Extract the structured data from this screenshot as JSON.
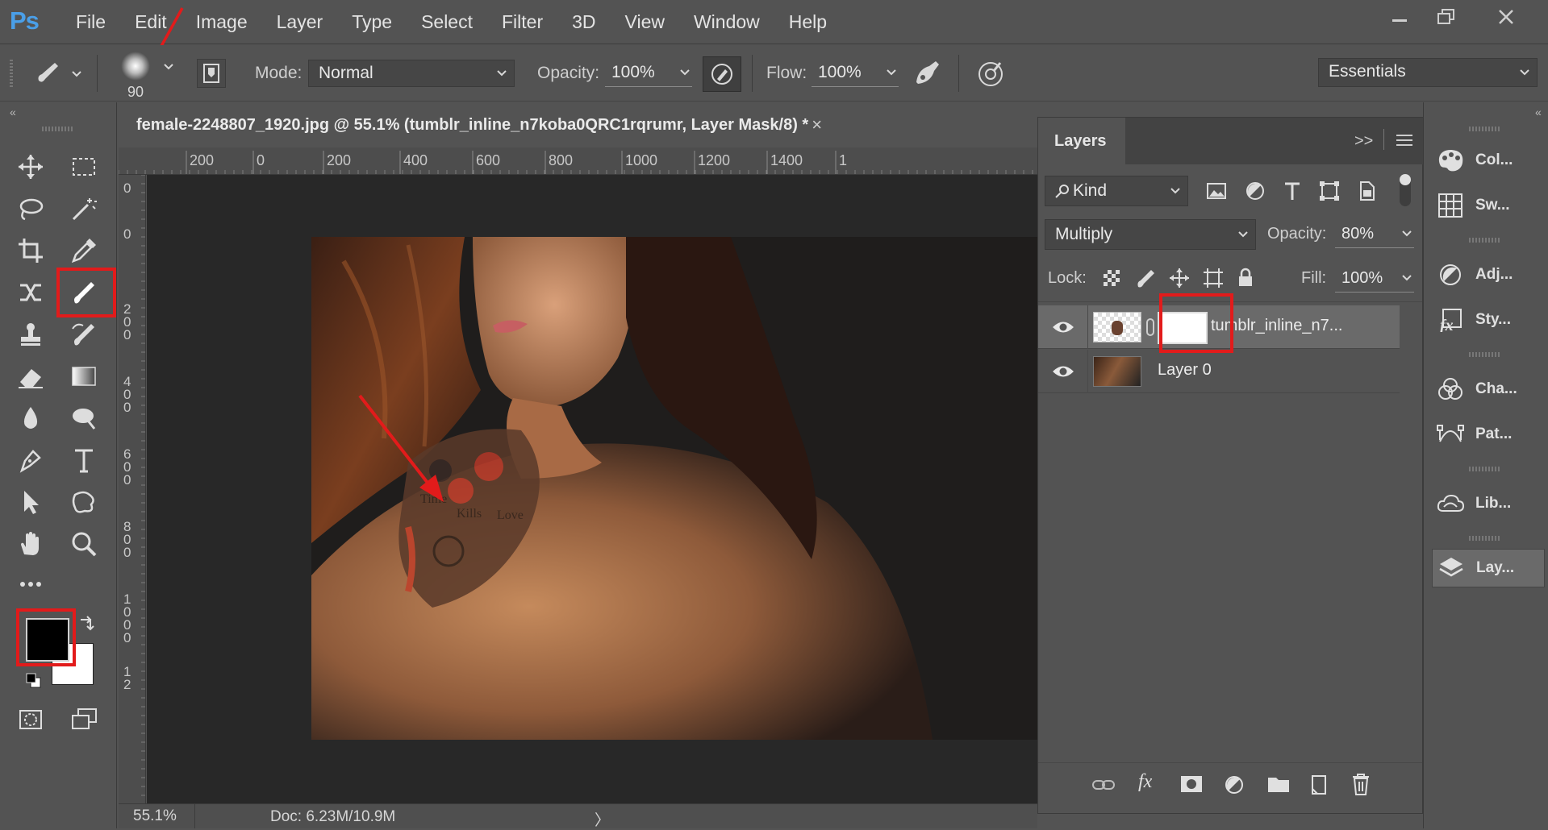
{
  "app": {
    "logo": "Ps"
  },
  "menu": [
    "File",
    "Edit",
    "Image",
    "Layer",
    "Type",
    "Select",
    "Filter",
    "3D",
    "View",
    "Window",
    "Help"
  ],
  "window_controls": [
    "minimize-icon",
    "restore-icon",
    "close-icon"
  ],
  "options_bar": {
    "brush_size": "90",
    "mode_label": "Mode:",
    "mode_value": "Normal",
    "opacity_label": "Opacity:",
    "opacity_value": "100%",
    "flow_label": "Flow:",
    "flow_value": "100%",
    "workspace": "Essentials"
  },
  "document": {
    "tab_title": "female-2248807_1920.jpg @ 55.1% (tumblr_inline_n7koba0QRC1rqrumr, Layer Mask/8) *",
    "close_glyph": "×",
    "ruler_h": [
      "200",
      "0",
      "200",
      "400",
      "600",
      "800",
      "1000",
      "1200",
      "1400",
      "1"
    ],
    "ruler_v": [
      "0",
      "0",
      "2\n0\n0",
      "4\n0\n0",
      "6\n0\n0",
      "8\n0\n0",
      "1\n0\n0\n0",
      "1\n2"
    ]
  },
  "status": {
    "zoom": "55.1%",
    "doc_info": "Doc: 6.23M/10.9M",
    "arrow": "〉"
  },
  "layers_panel": {
    "tab": "Layers",
    "filter_label": "Kind",
    "blend_mode": "Multiply",
    "opacity_label": "Opacity:",
    "opacity_value": "80%",
    "lock_label": "Lock:",
    "fill_label": "Fill:",
    "fill_value": "100%",
    "layers": [
      {
        "name": "tumblr_inline_n7...",
        "visible": true,
        "selected": true,
        "has_mask": true
      },
      {
        "name": "Layer 0",
        "visible": true,
        "selected": false,
        "has_mask": false
      }
    ]
  },
  "dock": {
    "items": [
      {
        "label": "Col...",
        "icon": "palette-icon"
      },
      {
        "label": "Sw...",
        "icon": "swatches-icon"
      },
      {
        "label": "Adj...",
        "icon": "adjustments-icon"
      },
      {
        "label": "Sty...",
        "icon": "styles-icon"
      },
      {
        "label": "Cha...",
        "icon": "channels-icon"
      },
      {
        "label": "Pat...",
        "icon": "paths-icon"
      },
      {
        "label": "Lib...",
        "icon": "libraries-icon"
      },
      {
        "label": "Lay...",
        "icon": "layers-icon"
      }
    ]
  },
  "colors": {
    "foreground": "#000000",
    "background": "#ffffff",
    "annotation": "#e21b1b",
    "ui_bg": "#535353"
  },
  "tattoo_text": [
    "Time",
    "Kills",
    "Love"
  ]
}
